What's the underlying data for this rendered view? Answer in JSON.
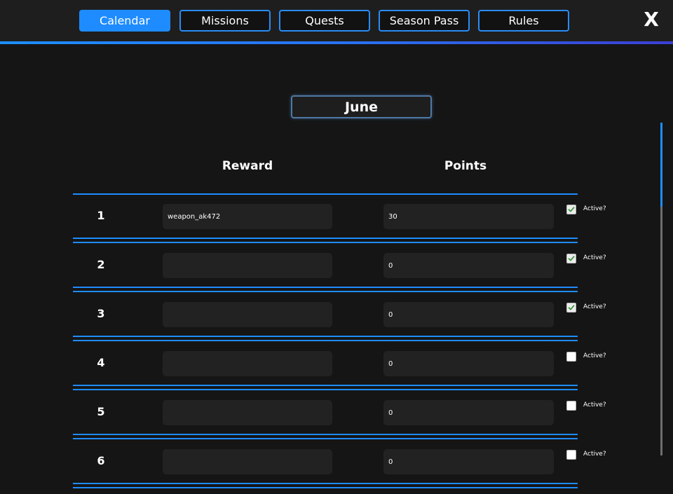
{
  "tabs": [
    {
      "label": "Calendar",
      "active": true
    },
    {
      "label": "Missions",
      "active": false
    },
    {
      "label": "Quests",
      "active": false
    },
    {
      "label": "Season Pass",
      "active": false
    },
    {
      "label": "Rules",
      "active": false
    }
  ],
  "close_label": "X",
  "month": "June",
  "columns": {
    "reward": "Reward",
    "points": "Points"
  },
  "active_label": "Active?",
  "rows": [
    {
      "num": "1",
      "reward": "weapon_ak472",
      "points": "30",
      "active": true
    },
    {
      "num": "2",
      "reward": "",
      "points": "0",
      "active": true
    },
    {
      "num": "3",
      "reward": "",
      "points": "0",
      "active": true
    },
    {
      "num": "4",
      "reward": "",
      "points": "0",
      "active": false
    },
    {
      "num": "5",
      "reward": "",
      "points": "0",
      "active": false
    },
    {
      "num": "6",
      "reward": "",
      "points": "0",
      "active": false
    }
  ],
  "colors": {
    "accent": "#1e8cff",
    "background": "#151515",
    "topbar": "#1e1e1e",
    "field": "#222222",
    "check": "#3c9a3c"
  }
}
